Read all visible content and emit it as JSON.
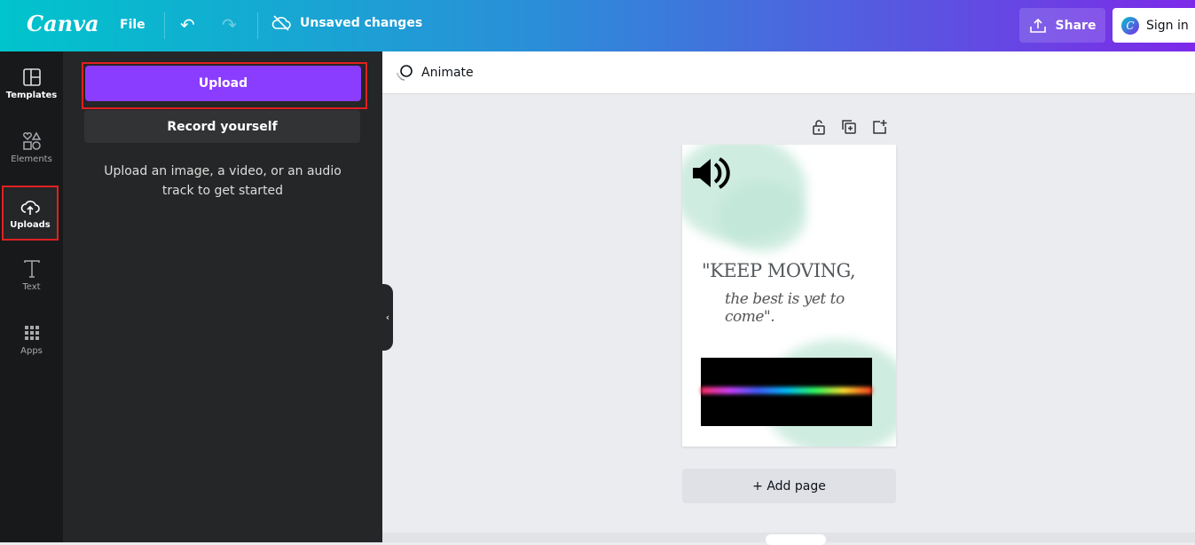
{
  "header": {
    "logo": "Canva",
    "file_label": "File",
    "status": "Unsaved changes",
    "share_label": "Share",
    "signin_label": "Sign in",
    "gradient_start": "#00c4cc",
    "gradient_end": "#7d2ae8"
  },
  "sidebar": {
    "items": [
      {
        "label": "Templates",
        "icon": "templates-icon"
      },
      {
        "label": "Elements",
        "icon": "shapes-icon"
      },
      {
        "label": "Uploads",
        "icon": "cloud-upload-icon",
        "active": true
      },
      {
        "label": "Text",
        "icon": "text-icon"
      },
      {
        "label": "Apps",
        "icon": "grid-icon"
      }
    ]
  },
  "panel": {
    "upload_label": "Upload",
    "record_label": "Record yourself",
    "hint": "Upload an image, a video, or an audio track to get started",
    "accent": "#8b3dff"
  },
  "toolbar": {
    "animate_label": "Animate"
  },
  "canvas": {
    "quote_line1": "\"KEEP MOVING,",
    "quote_line2": "the best is yet to come\".",
    "add_page_label": "+ Add page"
  }
}
